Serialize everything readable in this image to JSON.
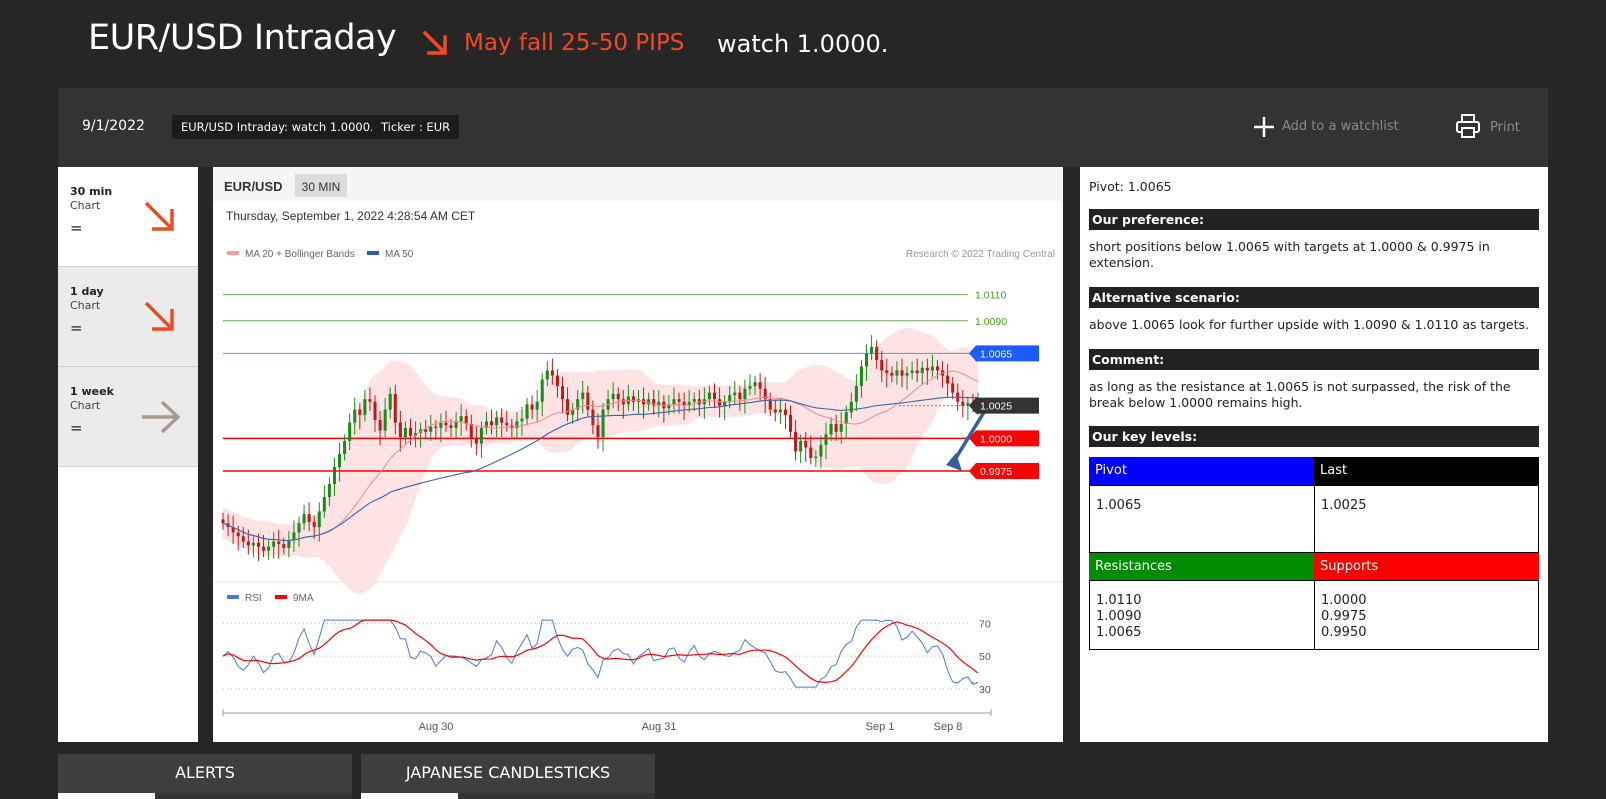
{
  "header": {
    "title": "EUR/USD Intraday",
    "trend_text": "May fall 25-50 PIPS",
    "watch_text": "watch 1.0000.",
    "trend_icon": "arrow-down-right-icon",
    "trend_color": "#f04a23"
  },
  "toolbar": {
    "date": "9/1/2022",
    "tag_title": "EUR/USD Intraday: watch 1.0000.",
    "tag_ticker": "Ticker : EUR",
    "add_label": "Add to a watchlist",
    "print_label": "Print"
  },
  "timeframes": [
    {
      "name": "30 min",
      "sub": "Chart",
      "value": "=",
      "arrow": "arrow-down-right-icon",
      "color": "#f04a23"
    },
    {
      "name": "1 day",
      "sub": "Chart",
      "value": "=",
      "arrow": "arrow-down-right-icon",
      "color": "#f04a23"
    },
    {
      "name": "1 week",
      "sub": "Chart",
      "value": "=",
      "arrow": "arrow-right-icon",
      "color": "#a89a8c"
    }
  ],
  "chart_header": {
    "symbol": "EUR/USD",
    "interval": "30 MIN",
    "datetime": "Thursday, September 1, 2022 4:28:54 AM CET",
    "legend_ma20": "MA 20 + Bollinger Bands",
    "legend_ma50": "MA 50",
    "copyright": "Research © 2022 Trading Central",
    "legend_rsi": "RSI",
    "legend_9ma": "9MA"
  },
  "chart_data": [
    {
      "type": "candlestick",
      "ylim": [
        0.989,
        1.0135
      ],
      "levels": [
        {
          "value": 1.011,
          "label": "1.0110",
          "kind": "target",
          "color": "#6aa84f"
        },
        {
          "value": 1.009,
          "label": "1.0090",
          "kind": "target",
          "color": "#6aa84f"
        },
        {
          "value": 1.0065,
          "label": "1.0065",
          "kind": "pivot",
          "color": "#1a5cff"
        },
        {
          "value": 1.0025,
          "label": "1.0025",
          "kind": "last",
          "color": "#333333"
        },
        {
          "value": 1.0,
          "label": "1.0000",
          "kind": "support",
          "color": "#ff0000"
        },
        {
          "value": 0.9975,
          "label": "0.9975",
          "kind": "support",
          "color": "#ff0000"
        }
      ],
      "close": [
        0.9935,
        0.9932,
        0.9928,
        0.9925,
        0.9921,
        0.9918,
        0.992,
        0.9917,
        0.9914,
        0.9917,
        0.9921,
        0.9919,
        0.9916,
        0.9922,
        0.9928,
        0.9935,
        0.9942,
        0.9936,
        0.9932,
        0.9944,
        0.9955,
        0.9965,
        0.9978,
        0.9988,
        0.9998,
        1.0012,
        1.0022,
        1.0018,
        1.003,
        1.0028,
        1.0014,
        1.0006,
        1.0022,
        1.0034,
        1.0012,
        1.0001,
        1.0008,
        1.0002,
        1.0004,
        1.0007,
        1.0005,
        1.0009,
        1.0008,
        1.0012,
        1.001,
        1.0008,
        1.0013,
        1.0017,
        1.0011,
        1.0,
        0.9996,
        1.0008,
        1.0013,
        1.001,
        1.0016,
        1.0012,
        1.001,
        1.0008,
        1.0013,
        1.0015,
        1.0026,
        1.0022,
        1.0028,
        1.0045,
        1.0052,
        1.0048,
        1.004,
        1.003,
        1.0018,
        1.0022,
        1.003,
        1.0035,
        1.0022,
        1.001,
        1.0001,
        1.0022,
        1.003,
        1.0034,
        1.003,
        1.0026,
        1.0032,
        1.0028,
        1.003,
        1.0026,
        1.003,
        1.0025,
        1.0028,
        1.0023,
        1.0026,
        1.003,
        1.0028,
        1.0025,
        1.0028,
        1.003,
        1.0026,
        1.003,
        1.0035,
        1.003,
        1.0025,
        1.0028,
        1.0033,
        1.0035,
        1.003,
        1.0038,
        1.004,
        1.0043,
        1.0038,
        1.003,
        1.0022,
        1.002,
        1.0022,
        1.0018,
        1.0005,
        0.999,
        0.9998,
        0.9993,
        0.9985,
        0.9986,
        0.9995,
        1.0003,
        1.0011,
        1.0005,
        1.0011,
        1.002,
        1.0028,
        1.004,
        1.0055,
        1.0065,
        1.007,
        1.006,
        1.0052,
        1.005,
        1.0048,
        1.0052,
        1.0048,
        1.005,
        1.0052,
        1.005,
        1.0054,
        1.0052,
        1.0055,
        1.0052,
        1.0048,
        1.0042,
        1.0035,
        1.0028,
        1.0025,
        1.0027,
        1.0025,
        1.0026
      ]
    },
    {
      "type": "line",
      "ylim": [
        25,
        80
      ],
      "yticks": [
        70,
        50,
        30
      ],
      "x_ticks": [
        "Aug 30",
        "Aug 31",
        "Sep 1",
        "Sep 8"
      ],
      "series": [
        {
          "name": "RSI",
          "color": "#4a78d6"
        },
        {
          "name": "9MA",
          "color": "#ff0000"
        }
      ]
    }
  ],
  "analysis": {
    "pivot": "Pivot: 1.0065",
    "preference_title": "Our preference:",
    "preference_text": "short positions below 1.0065 with targets at 1.0000 & 0.9975 in extension.",
    "alternative_title": "Alternative scenario:",
    "alternative_text": "above 1.0065 look for further upside with 1.0090 & 1.0110 as targets.",
    "comment_title": "Comment:",
    "comment_text": "as long as the resistance at 1.0065 is not surpassed, the risk of the break below 1.0000 remains high.",
    "key_levels_title": "Our key levels:",
    "pivot_head": "Pivot",
    "pivot_value": "1.0065",
    "last_head": "Last",
    "last_value": "1.0025",
    "res_head": "Resistances",
    "res_values": [
      "1.0110",
      "1.0090",
      "1.0065"
    ],
    "sup_head": "Supports",
    "sup_values": [
      "1.0000",
      "0.9975",
      "0.9950"
    ],
    "colors": {
      "pivot": "#0000ff",
      "last": "#000000",
      "resistances": "#008c00",
      "supports": "#ff0000"
    }
  },
  "bottom_tabs": {
    "alerts": "ALERTS",
    "candlesticks": "JAPANESE CANDLESTICKS"
  }
}
